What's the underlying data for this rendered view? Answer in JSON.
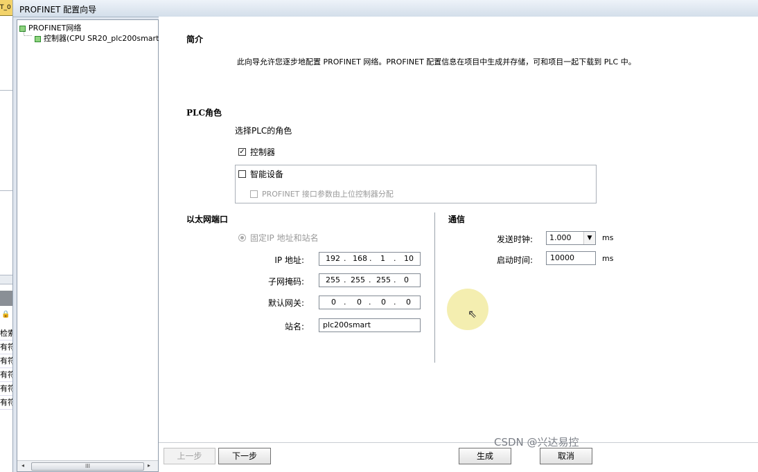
{
  "background_app": {
    "tab_label": "T_0",
    "list_items": [
      "检索",
      "有符",
      "有符",
      "有符",
      "有符",
      "有符"
    ]
  },
  "window": {
    "title": "PROFINET 配置向导"
  },
  "tree": {
    "root_label": "PROFINET网络",
    "child_label": "控制器(CPU SR20_plc200smart)",
    "scroll_thumb": "III"
  },
  "intro": {
    "title": "简介",
    "text": "此向导允许您逐步地配置 PROFINET 网络。PROFINET 配置信息在项目中生成并存储，可和项目一起下载到 PLC 中。"
  },
  "plc_role": {
    "title": "PLC角色",
    "prompt": "选择PLC的角色",
    "controller_label": "控制器",
    "controller_checked": true,
    "smart_device_label": "智能设备",
    "smart_device_checked": false,
    "assign_label": "PROFINET 接口参数由上位控制器分配",
    "assign_checked": false
  },
  "ethernet": {
    "title": "以太网端口",
    "fixed_ip_label": "固定IP 地址和站名",
    "ip_label": "IP 地址:",
    "ip": [
      "192",
      "168",
      "1",
      "10"
    ],
    "subnet_label": "子网掩码:",
    "subnet": [
      "255",
      "255",
      "255",
      "0"
    ],
    "gateway_label": "默认网关:",
    "gateway": [
      "0",
      "0",
      "0",
      "0"
    ],
    "station_label": "站名:",
    "station_name": "plc200smart"
  },
  "communication": {
    "title": "通信",
    "send_clock_label": "发送时钟:",
    "send_clock_value": "1.000",
    "send_clock_unit": "ms",
    "startup_label": "启动时间:",
    "startup_value": "10000",
    "startup_unit": "ms"
  },
  "buttons": {
    "prev": "上一步",
    "next": "下一步",
    "generate": "生成",
    "cancel": "取消"
  },
  "watermark": "CSDN @兴达易控",
  "colors": {
    "tree_node_green": "#8fd47f",
    "cursor_halo": "#f0e896"
  }
}
